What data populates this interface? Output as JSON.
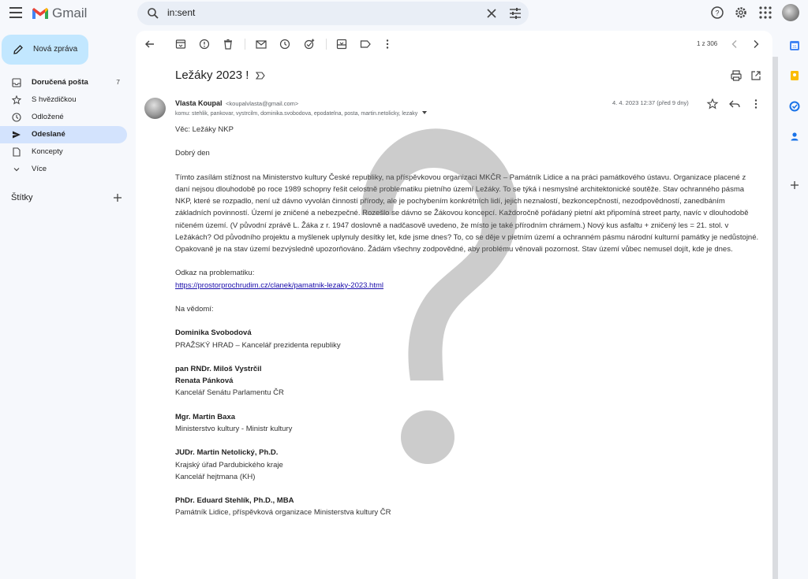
{
  "app": {
    "name": "Gmail"
  },
  "search": {
    "value": "in:sent"
  },
  "compose": {
    "label": "Nová zpráva"
  },
  "nav": [
    {
      "label": "Doručená pošta",
      "count": "7"
    },
    {
      "label": "S hvězdičkou",
      "count": ""
    },
    {
      "label": "Odložené",
      "count": ""
    },
    {
      "label": "Odeslané",
      "count": ""
    },
    {
      "label": "Koncepty",
      "count": ""
    },
    {
      "label": "Více",
      "count": ""
    }
  ],
  "labels_section": {
    "title": "Štítky"
  },
  "toolbar": {
    "pager": "1 z 306"
  },
  "email": {
    "subject": "Ležáky 2023 !",
    "sender_name": "Vlasta Koupal",
    "sender_email": "<koupalvlasta@gmail.com>",
    "recipients": "komu: stehlik, pankovar, vystrcilm, dominika.svobodova, epodatelna, posta, martin.netolicky, lezaky",
    "date": "4. 4. 2023 12:37 (před 9 dny)",
    "body": {
      "regarding": "Věc: Ležáky NKP",
      "greeting": "Dobrý den",
      "paragraph": "Tímto zasílám stížnost na Ministerstvo kultury České republiky, na příspěvkovou organizaci MKČR – Památník Lidice a na práci památkového ústavu. Organizace placené z daní nejsou dlouhodobě po roce 1989 schopny řešit celostně problematiku pietního území Ležáky. To se týká i nesmyslné architektonické soutěže. Stav ochranného pásma NKP, které se rozpadlo, není už dávno vyvolán činností přírody, ale je pochybením konkrétních lidí, jejich neznalostí, bezkoncepčností, nezodpovědností, zanedbáním základních povinností. Území je zničené a nebezpečné. Rozešlo se dávno se Žákovou koncepcí. Každoročně pořádaný pietní akt připomíná street party, navíc v dlouhodobě ničeném území. (V původní zprávě L. Žáka z r. 1947 doslovně a nadčasově uvedeno, že místo je také přírodním chrámem.) Nový kus asfaltu + zničený les = 21. stol. v Ležákách? Od původního projektu a myšlenek uplynuly desítky let, kde jsme dnes? To, co se děje v pietním území a ochranném pásmu národní kulturní památky je nedůstojné. Opakovaně je na stav území bezvýsledně upozorňováno. Žádám všechny zodpovědné, aby problému věnovali pozornost. Stav území vůbec nemusel dojít, kde je dnes.",
      "link_intro": "Odkaz na problematiku:",
      "link": "https://prostorprochrudim.cz/clanek/pamatnik-lezaky-2023.html",
      "cc_intro": "Na vědomí:",
      "contacts": [
        {
          "name": "Dominika Svobodová",
          "lines": [
            "PRAŽSKÝ HRAD – Kancelář prezidenta republiky"
          ]
        },
        {
          "name": "pan RNDr. Miloš Vystrčil",
          "name2": "Renata Pánková",
          "lines": [
            "Kancelář Senátu Parlamentu ČR"
          ]
        },
        {
          "name": "Mgr. Martin Baxa",
          "lines": [
            "Ministerstvo kultury - Ministr kultury"
          ]
        },
        {
          "name": "JUDr. Martin Netolický, Ph.D.",
          "lines": [
            "Krajský úřad Pardubického kraje",
            "Kancelář hejtmana (KH)"
          ]
        },
        {
          "name": "PhDr. Eduard Stehlík, Ph.D., MBA",
          "lines": [
            "Památník Lidice, příspěvková organizace Ministerstva kultury ČR"
          ]
        }
      ]
    }
  },
  "colors": {
    "accent": "#0b57d0",
    "compose_bg": "#c2e7ff",
    "active_nav_bg": "#d3e3fd",
    "app_bg": "#f6f8fc"
  }
}
